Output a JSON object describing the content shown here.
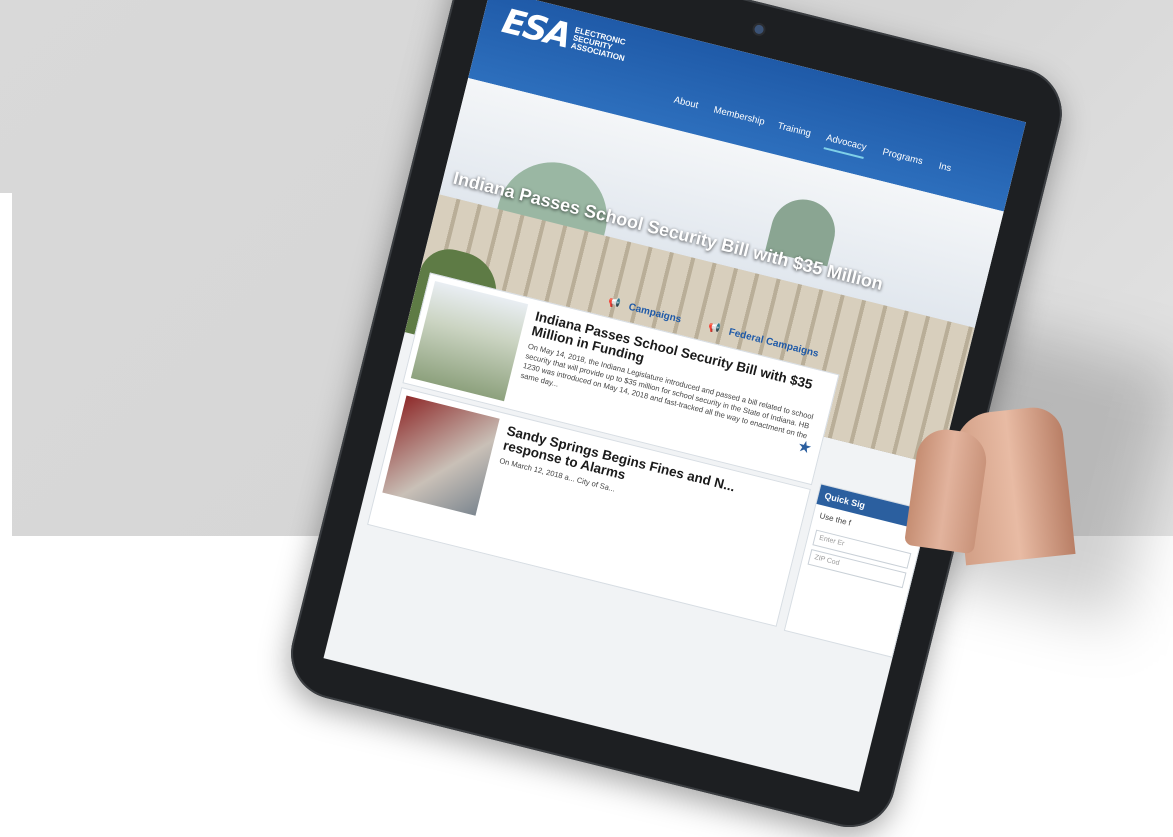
{
  "logo": {
    "mark": "ESA",
    "line1": "ELECTRONIC",
    "line2": "SECURITY",
    "line3": "ASSOCIATION"
  },
  "nav": {
    "items": [
      {
        "label": "About"
      },
      {
        "label": "Membership"
      },
      {
        "label": "Training"
      },
      {
        "label": "Advocacy",
        "active": true
      },
      {
        "label": "Programs"
      },
      {
        "label": "Ins"
      }
    ]
  },
  "hero": {
    "title": "Indiana Passes School Security Bill with $35 Million"
  },
  "tabs": [
    {
      "label": "Campaigns",
      "icon": "megaphone-icon"
    },
    {
      "label": "Federal Campaigns",
      "icon": "megaphone-icon"
    }
  ],
  "cards": [
    {
      "title": "Indiana Passes School Security Bill with $35 Million in Funding",
      "body": "On May 14, 2018, the Indiana Legislature introduced and passed a bill related to school security that will provide up to $35 million for school security in the State of Indiana. HB 1230 was introduced on May 14, 2018 and fast-tracked all the way to enactment on the same day..."
    },
    {
      "title": "Sandy Springs Begins Fines and N... response to Alarms",
      "body": "On March 12, 2018 a... City of Sa..."
    }
  ],
  "quick": {
    "title": "Quick Sig",
    "text": "Use the f",
    "input1_placeholder": "Enter Er",
    "input2_placeholder": "ZIP Cod"
  },
  "colors": {
    "brand_blue": "#1f5aa8",
    "accent": "#7fd0e8"
  }
}
